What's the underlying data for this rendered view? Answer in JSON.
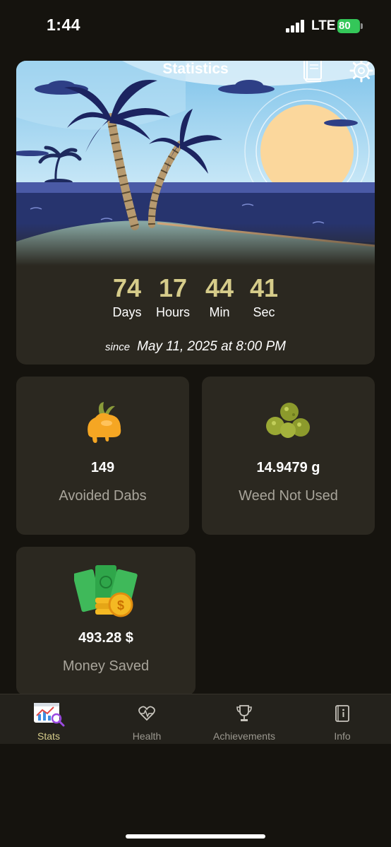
{
  "status_bar": {
    "time": "1:44",
    "network": "LTE",
    "battery": "80"
  },
  "hero": {
    "title": "Statistics",
    "counters": [
      {
        "value": "74",
        "label": "Days"
      },
      {
        "value": "17",
        "label": "Hours"
      },
      {
        "value": "44",
        "label": "Min"
      },
      {
        "value": "41",
        "label": "Sec"
      }
    ],
    "since_word": "since",
    "since_date": "May 11, 2025 at 8:00 PM"
  },
  "stats": {
    "dabs": {
      "value": "149",
      "label": "Avoided Dabs",
      "icon": "dab-icon"
    },
    "weed": {
      "value": "14.9479 g",
      "label": "Weed Not Used",
      "icon": "weed-icon"
    },
    "money": {
      "value": "493.28 $",
      "label": "Money Saved",
      "icon": "money-icon"
    }
  },
  "tabs": [
    {
      "label": "Stats",
      "icon": "stats-icon",
      "active": true
    },
    {
      "label": "Health",
      "icon": "heart-pulse-icon"
    },
    {
      "label": "Achievements",
      "icon": "trophy-icon"
    },
    {
      "label": "Info",
      "icon": "info-book-icon"
    }
  ],
  "colors": {
    "accent": "#d6cc8a",
    "background": "#15130e",
    "card": "#2b2820",
    "battery": "#34c759"
  }
}
